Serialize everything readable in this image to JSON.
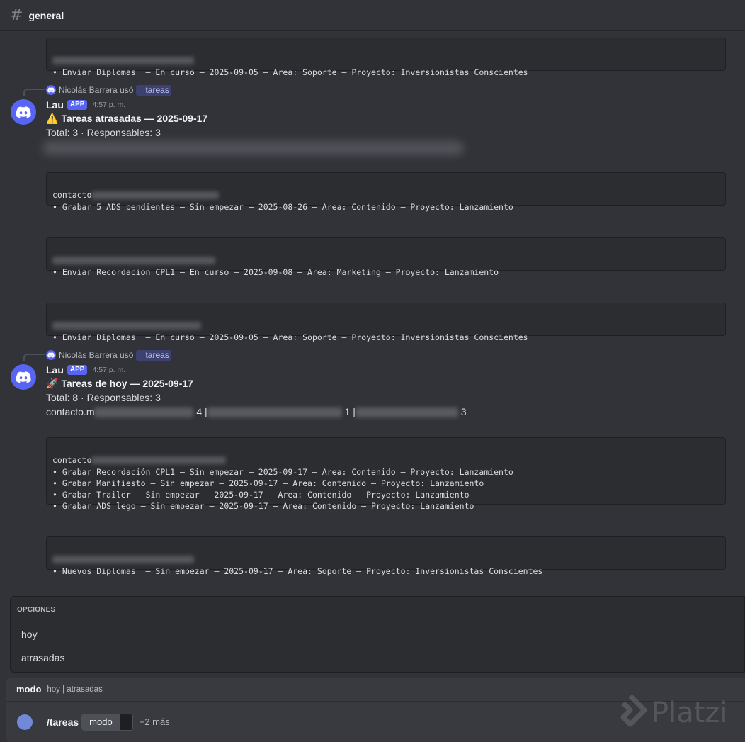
{
  "header": {
    "hash_icon": "#",
    "channel": "general"
  },
  "top_block": {
    "line": "• Enviar Diplomas  — En curso — 2025-09-05 — Area: Soporte — Proyecto: Inversionistas Conscientes"
  },
  "messages": [
    {
      "reply_user": "Nicolás Barrera usó",
      "command": "tareas",
      "author": "Lau",
      "badge": "APP",
      "time": "4:57 p. m.",
      "title_emoji": "⚠️",
      "title": "Tareas atrasadas — 2025-09-17",
      "summary": "Total: 3 · Responsables: 3",
      "blocks": [
        {
          "header": "contacto",
          "lines": [
            "• Grabar 5 ADS pendientes — Sin empezar — 2025-08-26 — Area: Contenido — Proyecto: Lanzamiento"
          ]
        },
        {
          "header": "",
          "lines": [
            "• Enviar Recordacion CPL1 — En curso — 2025-09-08 — Area: Marketing — Proyecto: Lanzamiento"
          ]
        },
        {
          "header": "",
          "lines": [
            "• Enviar Diplomas  — En curso — 2025-09-05 — Area: Soporte — Proyecto: Inversionistas Conscientes"
          ]
        }
      ]
    },
    {
      "reply_user": "Nicolás Barrera usó",
      "command": "tareas",
      "author": "Lau",
      "badge": "APP",
      "time": "4:57 p. m.",
      "title_emoji": "🚀",
      "title": "Tareas de hoy — 2025-09-17",
      "summary": "Total: 8 · Responsables: 3",
      "responsables_prefix": "contacto.m",
      "responsables_counts": [
        "4 |",
        "1 |",
        "3"
      ],
      "blocks": [
        {
          "header": "contacto",
          "lines": [
            "• Grabar Recordación CPL1 — Sin empezar — 2025-09-17 — Area: Contenido — Proyecto: Lanzamiento",
            "• Grabar Manifiesto — Sin empezar — 2025-09-17 — Area: Contenido — Proyecto: Lanzamiento",
            "• Grabar Trailer — Sin empezar — 2025-09-17 — Area: Contenido — Proyecto: Lanzamiento",
            "• Grabar ADS lego — Sin empezar — 2025-09-17 — Area: Contenido — Proyecto: Lanzamiento"
          ]
        },
        {
          "header": "",
          "lines": [
            "• Nuevos Diplomas  — Sin empezar — 2025-09-17 — Area: Soporte — Proyecto: Inversionistas Conscientes"
          ]
        }
      ]
    }
  ],
  "options": {
    "title": "OPCIONES",
    "items": [
      "hoy",
      "atrasadas"
    ]
  },
  "composer": {
    "param_name": "modo",
    "param_desc": "hoy | atrasadas",
    "command": "/tareas",
    "option_label": "modo",
    "more": "+2 más"
  },
  "watermark": "Platzi",
  "colors": {
    "background": "#323339",
    "blurple": "#5865f2",
    "codeblock": "#2b2d31"
  }
}
